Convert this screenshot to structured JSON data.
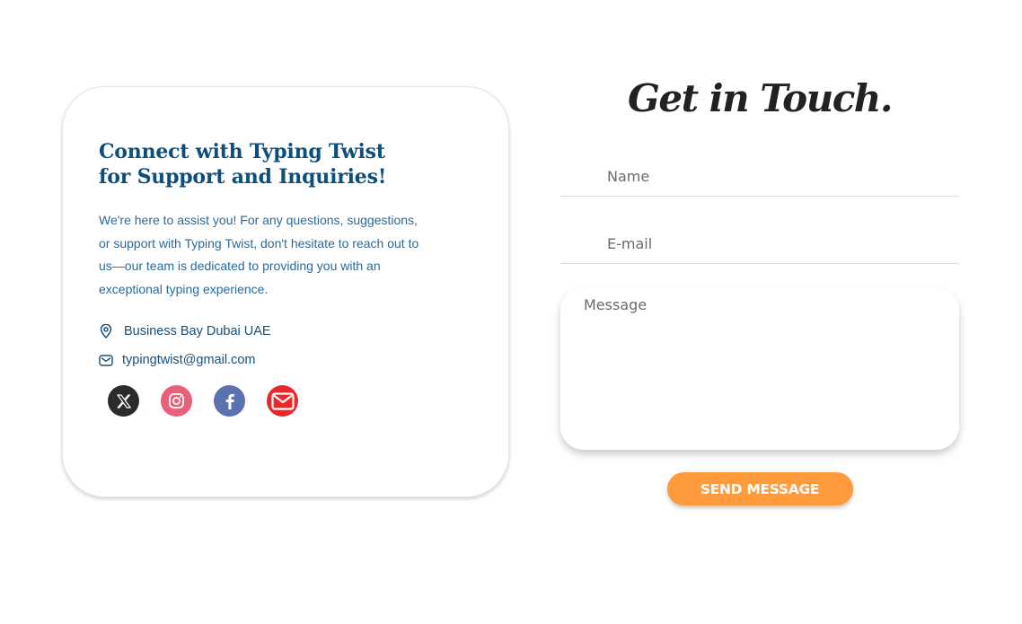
{
  "info": {
    "title": "Connect with Typing Twist for Support and Inquiries!",
    "description": "We're here to assist you! For any questions, suggestions, or support with Typing Twist, don't hesitate to reach out to us—our team is dedicated to providing you with an exceptional typing experience.",
    "address": "Business Bay Dubai UAE",
    "email": "typingtwist@gmail.com",
    "socials": [
      {
        "icon": "x-icon",
        "color": "#2b2b2b"
      },
      {
        "icon": "instagram-icon",
        "color": "#e8607a"
      },
      {
        "icon": "facebook-icon",
        "color": "#5a73b0"
      },
      {
        "icon": "mail-icon",
        "color": "#e8282b"
      }
    ],
    "colors": {
      "heading": "#0d4f7c",
      "text": "#2a6a9a"
    }
  },
  "form": {
    "title": "Get in Touch.",
    "name_placeholder": "Name",
    "email_placeholder": "E-mail",
    "message_placeholder": "Message",
    "send_label": "SEND MESSAGE",
    "button_color": "#ff9a3d"
  }
}
